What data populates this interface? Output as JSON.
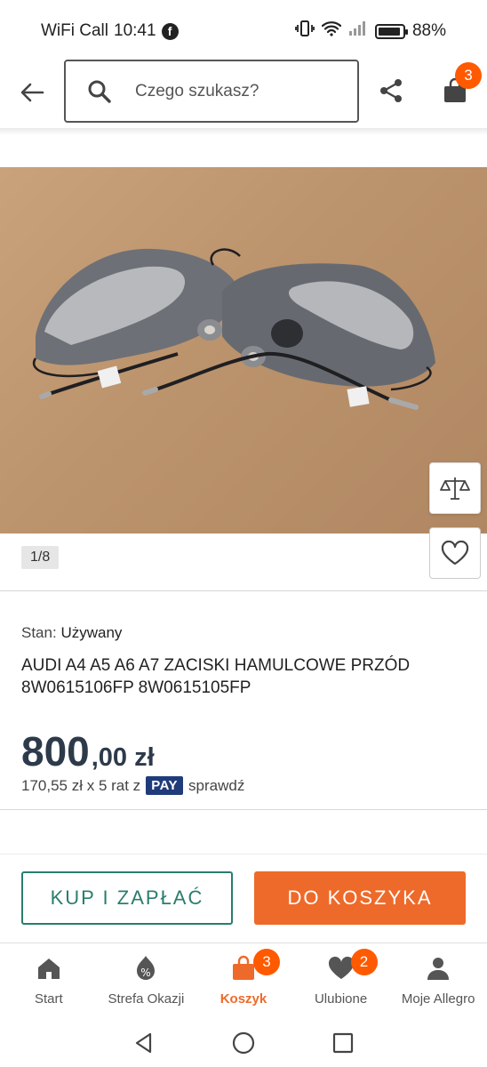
{
  "status_bar": {
    "carrier": "WiFi Call",
    "time": "10:41",
    "facebook_glyph": "f",
    "battery": "88%"
  },
  "header": {
    "search_placeholder": "Czego szukasz?",
    "cart_count": "3"
  },
  "gallery": {
    "pager": "1/8"
  },
  "product": {
    "condition_label": "Stan:",
    "condition_value": "Używany",
    "title": "AUDI A4 A5 A6 A7 ZACISKI HAMULCOWE PRZÓD 8W0615106FP 8W0615105FP",
    "price_int": "800",
    "price_dec": ",00",
    "price_currency": "zł",
    "installment_text": "170,55 zł x 5 rat z",
    "pay_badge": "PAY",
    "installment_link": "sprawdź"
  },
  "actions": {
    "buy_now": "KUP I ZAPŁAĆ",
    "add_to_cart": "DO KOSZYKA"
  },
  "bottom_nav": {
    "items": [
      {
        "label": "Start",
        "icon": "home-icon"
      },
      {
        "label": "Strefa Okazji",
        "icon": "percent-tag-icon"
      },
      {
        "label": "Koszyk",
        "icon": "shopping-bag-icon",
        "badge": "3",
        "active": true
      },
      {
        "label": "Ulubione",
        "icon": "heart-icon",
        "badge": "2"
      },
      {
        "label": "Moje Allegro",
        "icon": "person-icon"
      }
    ]
  },
  "colors": {
    "accent_orange": "#ee6a2a",
    "badge_orange": "#ff5a00",
    "buy_green": "#2a7d6e",
    "price_navy": "#2d3a4a",
    "pay_blue": "#1f3b7a"
  }
}
